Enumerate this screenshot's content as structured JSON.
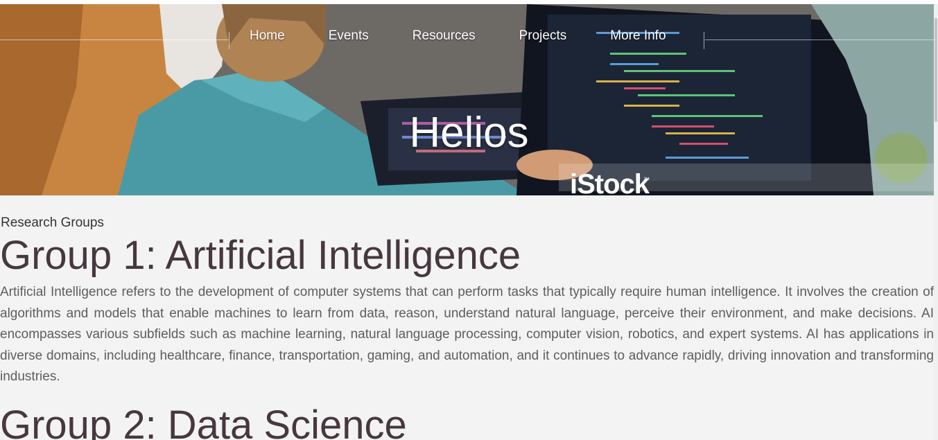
{
  "header": {
    "nav": [
      "Home",
      "Events",
      "Resources",
      "Projects",
      "More Info"
    ],
    "title": "Helios",
    "watermark": "iStock",
    "watermark_tm": "™"
  },
  "content": {
    "section_label": "Research Groups",
    "groups": [
      {
        "heading": "Group 1: Artificial Intelligence",
        "text": "Artificial Intelligence refers to the development of computer systems that can perform tasks that typically require human intelligence. It involves the creation of algorithms and models that enable machines to learn from data, reason, understand natural language, perceive their environment, and make decisions. AI encompasses various subfields such as machine learning, natural language processing, computer vision, robotics, and expert systems. AI has applications in diverse domains, including healthcare, finance, transportation, gaming, and automation, and it continues to advance rapidly, driving innovation and transforming industries."
      },
      {
        "heading": "Group 2: Data Science"
      }
    ]
  },
  "colors": {
    "page_background": "#f3f3f3",
    "heading": "#47373f",
    "body_text": "#5d5d5d",
    "nav_text": "#ffffff"
  }
}
